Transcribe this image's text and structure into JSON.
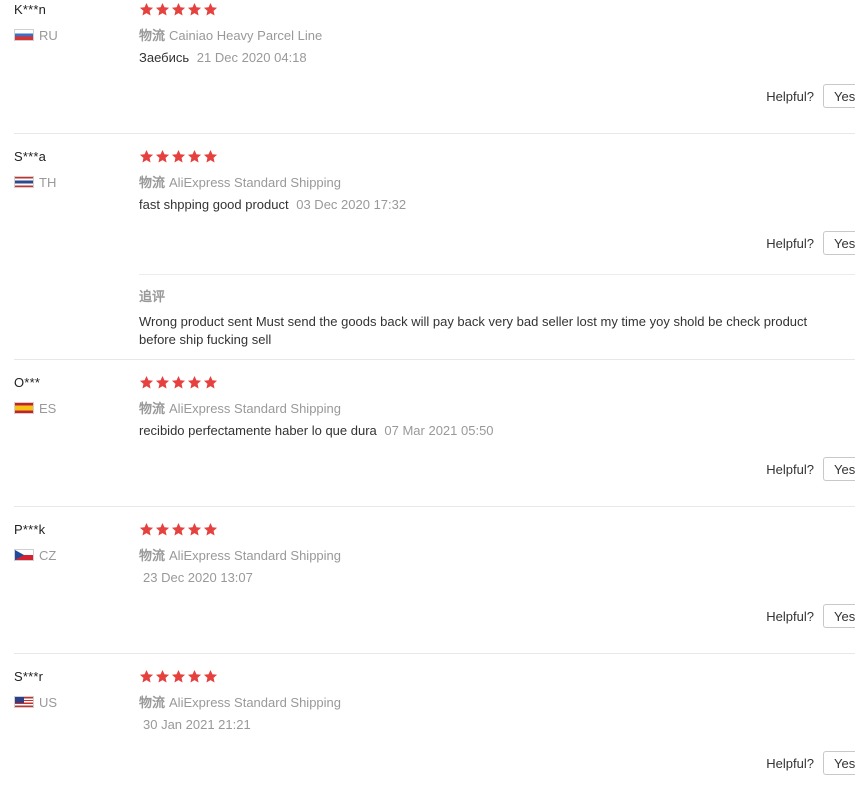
{
  "colors": {
    "star": "#e5413e",
    "muted_text": "#999999",
    "body_text": "#333333",
    "separator": "#e8e8e8"
  },
  "labels": {
    "helpful": "Helpful?",
    "yes_button": "Yes",
    "logistics_label": "物流",
    "followup_title": "追评"
  },
  "reviews": [
    {
      "user": "K***n",
      "country": "RU",
      "flag_icon": "flag-ru-icon",
      "stars": 5,
      "shipping": "Cainiao Heavy Parcel Line",
      "text": "Заебись",
      "date": "21 Dec 2020 04:18"
    },
    {
      "user": "S***a",
      "country": "TH",
      "flag_icon": "flag-th-icon",
      "stars": 5,
      "shipping": "AliExpress Standard Shipping",
      "text": "fast shpping good product",
      "date": "03 Dec 2020 17:32",
      "followup": "Wrong product sent Must send the goods back will pay back very bad seller lost my time yoy shold be check product before ship fucking sell"
    },
    {
      "user": "O***",
      "country": "ES",
      "flag_icon": "flag-es-icon",
      "stars": 5,
      "shipping": "AliExpress Standard Shipping",
      "text": "recibido perfectamente haber lo que dura",
      "date": "07 Mar 2021 05:50"
    },
    {
      "user": "P***k",
      "country": "CZ",
      "flag_icon": "flag-cz-icon",
      "stars": 5,
      "shipping": "AliExpress Standard Shipping",
      "text": "",
      "date": "23 Dec 2020 13:07"
    },
    {
      "user": "S***r",
      "country": "US",
      "flag_icon": "flag-us-icon",
      "stars": 5,
      "shipping": "AliExpress Standard Shipping",
      "text": "",
      "date": "30 Jan 2021 21:21"
    }
  ]
}
